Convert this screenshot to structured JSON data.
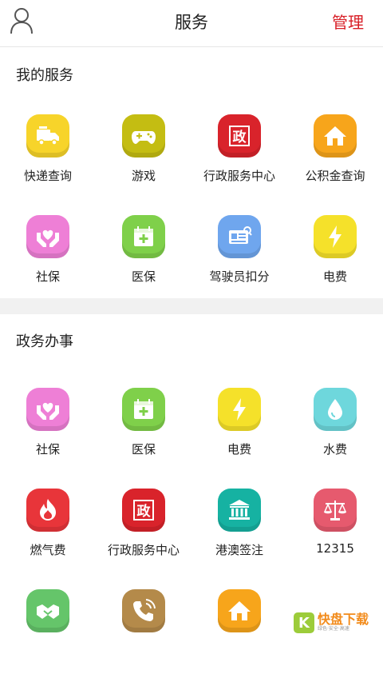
{
  "header": {
    "title": "服务",
    "manage_label": "管理",
    "user_icon": "user-icon"
  },
  "my_services": {
    "title": "我的服务",
    "items": [
      {
        "label": "快递查询",
        "icon": "delivery-truck-icon",
        "color": "#f7d42a"
      },
      {
        "label": "游戏",
        "icon": "gamepad-icon",
        "color": "#c4bd12"
      },
      {
        "label": "行政服务中心",
        "icon": "government-icon",
        "color": "#d9232b"
      },
      {
        "label": "公积金查询",
        "icon": "house-icon",
        "color": "#f7a51b"
      },
      {
        "label": "社保",
        "icon": "hands-heart-icon",
        "color": "#ee7fd6"
      },
      {
        "label": "医保",
        "icon": "medical-calendar-icon",
        "color": "#7fd04a"
      },
      {
        "label": "驾驶员扣分",
        "icon": "license-card-icon",
        "color": "#6fa6ee"
      },
      {
        "label": "电费",
        "icon": "lightning-icon",
        "color": "#f5e12a"
      }
    ]
  },
  "gov_services": {
    "title": "政务办事",
    "items": [
      {
        "label": "社保",
        "icon": "hands-heart-icon",
        "color": "#ee7fd6"
      },
      {
        "label": "医保",
        "icon": "medical-calendar-icon",
        "color": "#7fd04a"
      },
      {
        "label": "电费",
        "icon": "lightning-icon",
        "color": "#f5e12a"
      },
      {
        "label": "水费",
        "icon": "water-drop-icon",
        "color": "#6ed7dc"
      },
      {
        "label": "燃气费",
        "icon": "flame-icon",
        "color": "#e8353a"
      },
      {
        "label": "行政服务中心",
        "icon": "government-icon",
        "color": "#d9232b"
      },
      {
        "label": "港澳签注",
        "icon": "building-columns-icon",
        "color": "#16b2a2"
      },
      {
        "label": "12315",
        "icon": "scales-icon",
        "color": "#e65a6e"
      },
      {
        "label": "",
        "icon": "handshake-icon",
        "color": "#65c56a"
      },
      {
        "label": "",
        "icon": "phone-call-icon",
        "color": "#b48a4a"
      },
      {
        "label": "",
        "icon": "house-icon",
        "color": "#f7a51b"
      }
    ]
  },
  "watermark": {
    "mark": "K",
    "text": "快盘下载",
    "sub": "绿色·安全·高速"
  }
}
